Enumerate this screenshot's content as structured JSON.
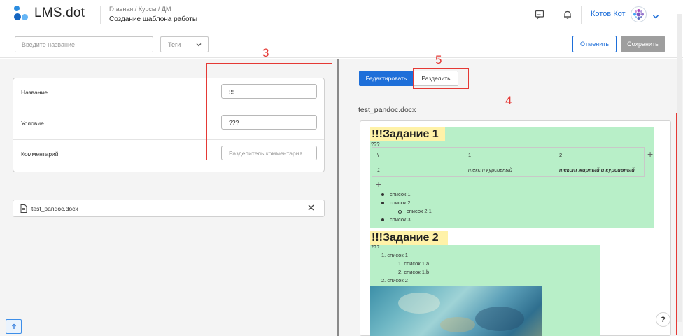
{
  "app": {
    "logo_text": "LMS.dot"
  },
  "header": {
    "breadcrumb": "Главная / Курсы / ДМ",
    "title": "Создание шаблона работы",
    "user_name": "Котов Кот"
  },
  "toolbar": {
    "name_placeholder": "Введите название",
    "tags_label": "Теги",
    "cancel_label": "Отменить",
    "save_label": "Сохранить"
  },
  "fields": [
    {
      "label": "Название",
      "value": "!!!",
      "placeholder": ""
    },
    {
      "label": "Условие",
      "value": "???",
      "placeholder": ""
    },
    {
      "label": "Комментарий",
      "value": "",
      "placeholder": "Разделитель комментария"
    }
  ],
  "file": {
    "name": "test_pandoc.docx"
  },
  "view": {
    "edit_label": "Редактировать",
    "split_label": "Разделить"
  },
  "document": {
    "title": "test_pandoc.docx",
    "task1": {
      "heading": "!!!Задание 1",
      "question": "???",
      "table": [
        [
          "\\",
          "1",
          "2"
        ],
        [
          "1",
          "текст курсивный",
          "текст жирный и курсивный"
        ]
      ],
      "list": [
        "список 1",
        "список 2",
        "список 2.1",
        "список 3"
      ]
    },
    "task2": {
      "heading": "!!!Задание 2",
      "question": "???",
      "list": [
        "1. список 1",
        "1. список 1.a",
        "2. список 1.b",
        "2. список 2"
      ]
    }
  },
  "annotations": {
    "a3": "3",
    "a4": "4",
    "a5": "5"
  },
  "colors": {
    "accent": "#1e6fd9",
    "highlight_green": "#b8efc8",
    "highlight_yellow": "#fff2a8",
    "annotation_red": "#e53935"
  },
  "icons": {
    "comment": "message-square-icon",
    "notifications": "bell-icon",
    "file": "file-icon",
    "close": "close-icon",
    "up": "arrow-up-icon",
    "help": "question-icon"
  }
}
